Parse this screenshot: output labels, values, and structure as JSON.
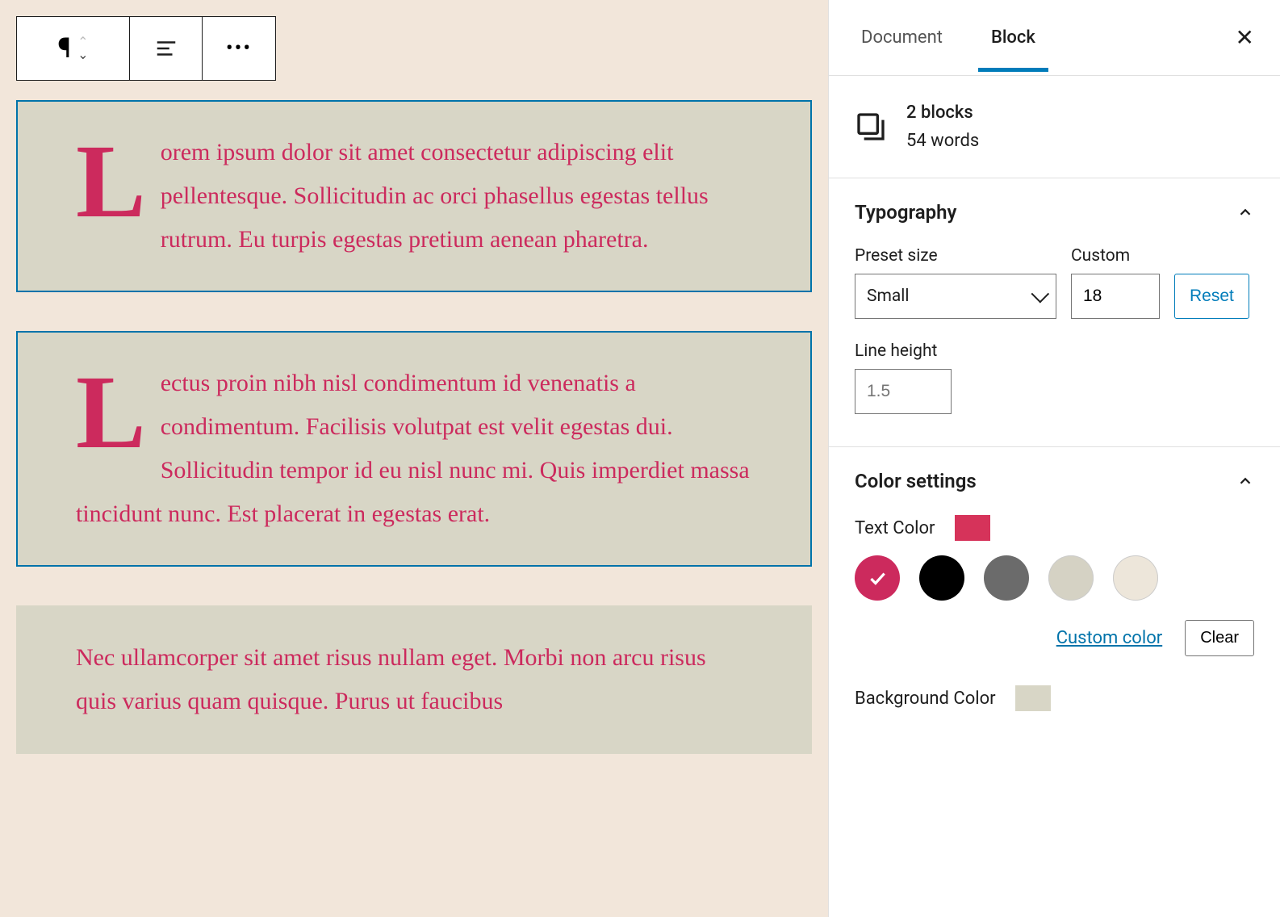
{
  "toolbar": {
    "block_type": "paragraph",
    "align": "left",
    "more": "more-options"
  },
  "blocks": [
    {
      "text": "Lorem ipsum dolor sit amet consectetur adipiscing elit pellentesque. Sollicitudin ac orci phasellus egestas tellus rutrum. Eu turpis egestas pretium aenean pharetra.",
      "selected": true,
      "dropcap": true
    },
    {
      "text": "Lectus proin nibh nisl condimentum id venenatis a condimentum. Facilisis volutpat est velit egestas dui. Sollicitudin tempor id eu nisl nunc mi. Quis imperdiet massa tincidunt nunc. Est placerat in egestas erat.",
      "selected": true,
      "dropcap": true
    },
    {
      "text": "Nec ullamcorper sit amet risus nullam eget. Morbi non arcu risus quis varius quam quisque. Purus ut faucibus",
      "selected": false,
      "dropcap": false
    }
  ],
  "sidebar": {
    "tabs": {
      "document": "Document",
      "block": "Block",
      "active": "block"
    },
    "summary": {
      "line1": "2 blocks",
      "line2": "54 words"
    },
    "typography": {
      "title": "Typography",
      "preset_label": "Preset size",
      "preset_value": "Small",
      "custom_label": "Custom",
      "custom_value": "18",
      "reset_label": "Reset",
      "line_height_label": "Line height",
      "line_height_value": "1.5"
    },
    "color": {
      "title": "Color settings",
      "text_color_label": "Text Color",
      "text_color_value": "#d6335a",
      "swatches": [
        {
          "hex": "#cc2a5d",
          "selected": true
        },
        {
          "hex": "#000000",
          "selected": false
        },
        {
          "hex": "#6b6b6b",
          "selected": false
        },
        {
          "hex": "#d5d2c4",
          "selected": false
        },
        {
          "hex": "#ede6da",
          "selected": false
        }
      ],
      "custom_link": "Custom color",
      "clear_label": "Clear",
      "bg_color_label": "Background Color",
      "bg_color_value": "#d8d6c6"
    }
  }
}
